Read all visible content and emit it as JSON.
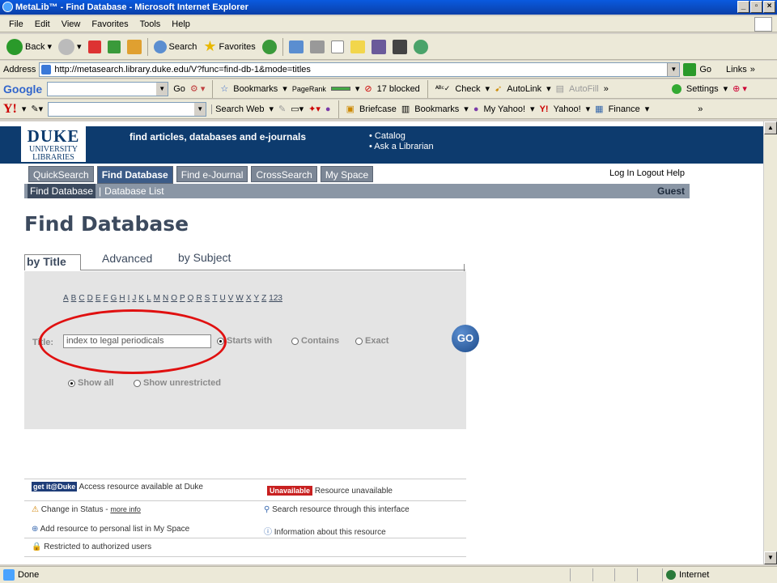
{
  "window": {
    "title": "MetaLib™ - Find Database - Microsoft Internet Explorer"
  },
  "menu": [
    "File",
    "Edit",
    "View",
    "Favorites",
    "Tools",
    "Help"
  ],
  "toolbar": {
    "back": "Back",
    "search": "Search",
    "favorites": "Favorites"
  },
  "address": {
    "label": "Address",
    "url": "http://metasearch.library.duke.edu/V?func=find-db-1&mode=titles",
    "go": "Go",
    "links": "Links"
  },
  "google": {
    "go": "Go",
    "bookmarks": "Bookmarks",
    "pagerank": "PageRank",
    "blocked": "17 blocked",
    "check": "Check",
    "autolink": "AutoLink",
    "autofill": "AutoFill",
    "settings": "Settings"
  },
  "yahoo": {
    "search_web": "Search Web",
    "briefcase": "Briefcase",
    "bookmarks": "Bookmarks",
    "my_yahoo": "My Yahoo!",
    "yahoo": "Yahoo!",
    "finance": "Finance"
  },
  "page": {
    "logo_line1": "DUKE",
    "logo_line2": "UNIVERSITY",
    "logo_line3": "LIBRARIES",
    "tagline": "find articles, databases and e-journals",
    "header_links": [
      "• Catalog",
      "• Ask a Librarian"
    ],
    "tabs": [
      "QuickSearch",
      "Find Database",
      "Find e-Journal",
      "CrossSearch",
      "My Space"
    ],
    "user_links": [
      "Log In",
      "Logout",
      "Help"
    ],
    "sub_current": "Find Database",
    "sub_other": "Database List",
    "guest": "Guest",
    "title": "Find Database",
    "search_tabs": [
      "by Title",
      "Advanced",
      "by Subject"
    ],
    "alphabet": [
      "A",
      "B",
      "C",
      "D",
      "E",
      "F",
      "G",
      "H",
      "I",
      "J",
      "K",
      "L",
      "M",
      "N",
      "O",
      "P",
      "Q",
      "R",
      "S",
      "T",
      "U",
      "V",
      "W",
      "X",
      "Y",
      "Z",
      "123"
    ],
    "title_label": "Title:",
    "title_value": "index to legal periodicals",
    "match_options": [
      "Starts with",
      "Contains",
      "Exact"
    ],
    "show_options": [
      "Show all",
      "Show unrestricted"
    ],
    "go": "GO",
    "legend": {
      "getit": "get it@Duke",
      "getit_text": "Access resource available at Duke",
      "unavailable": "Unavailable",
      "unavailable_text": "Resource unavailable",
      "change": "Change in Status - ",
      "more_info": "more info",
      "search": "Search resource through this interface",
      "add": "Add resource to personal list in My Space",
      "info": "Information about this resource",
      "restricted": "Restricted to authorized users"
    }
  },
  "status": {
    "text": "Done",
    "zone": "Internet"
  }
}
